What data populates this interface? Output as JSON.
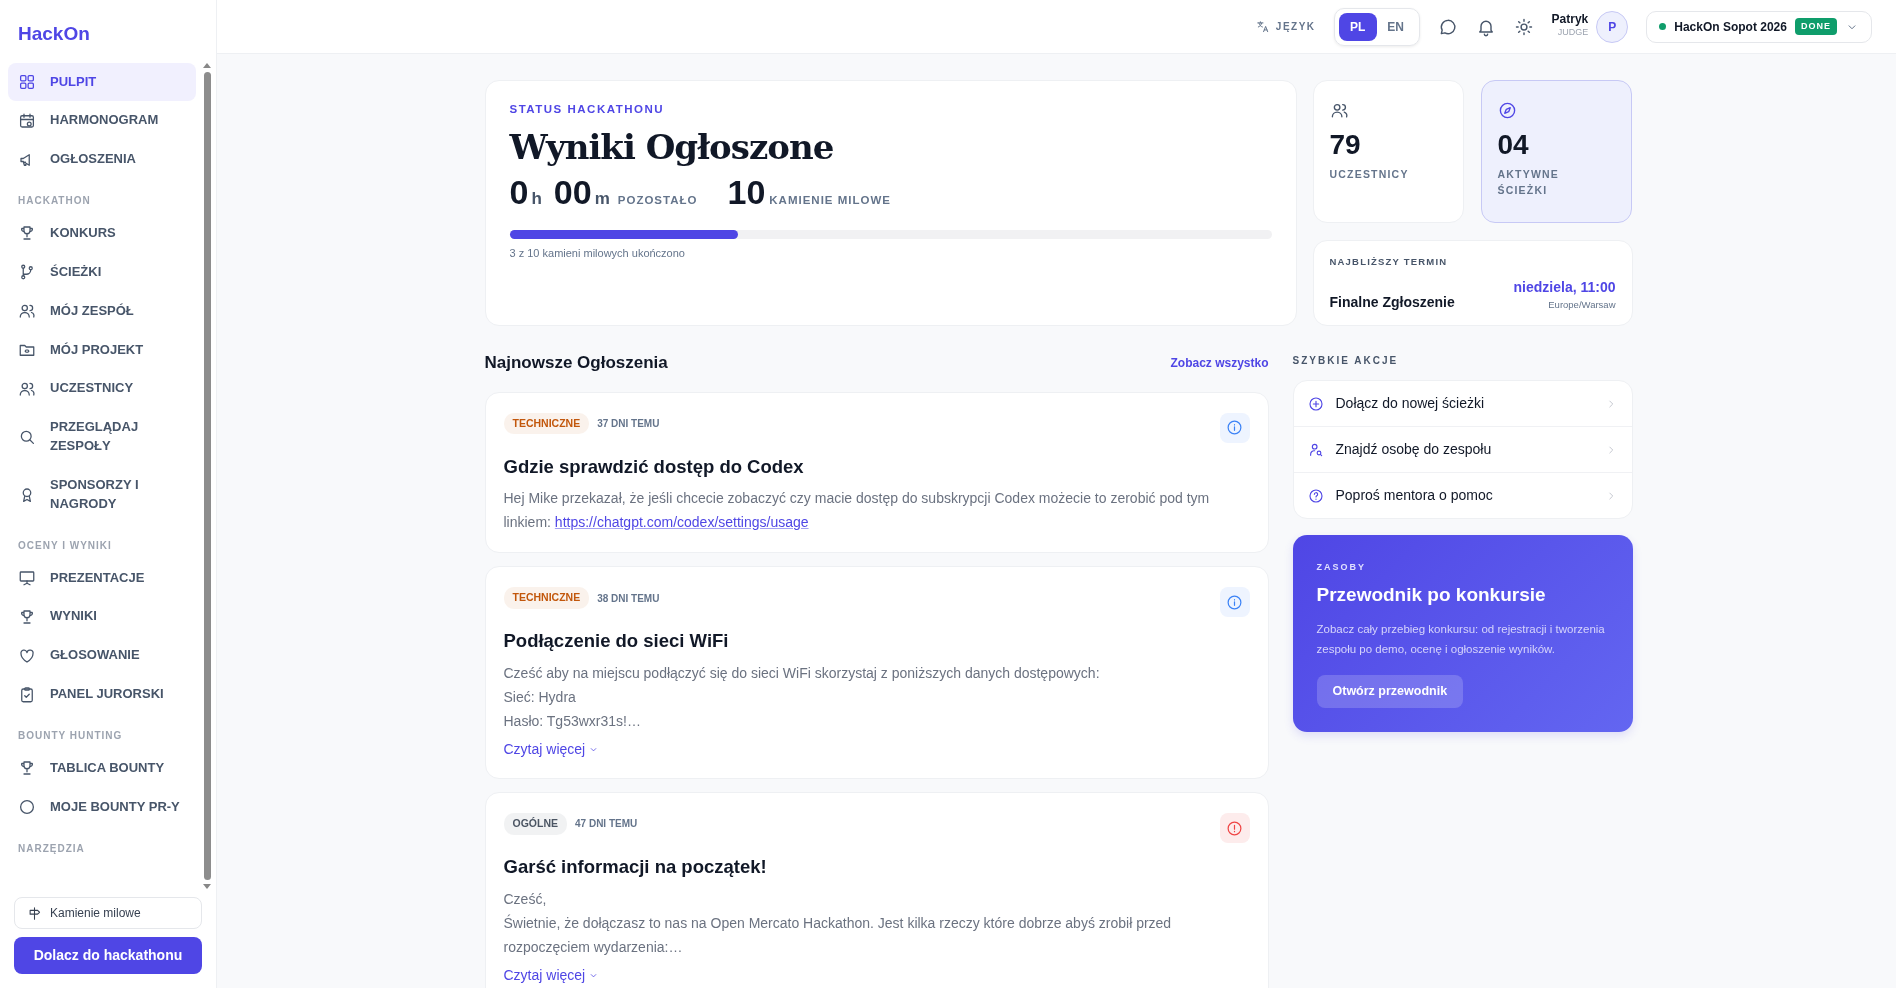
{
  "brand": "HackOn",
  "sidebar": {
    "groups": [
      {
        "items": [
          {
            "label": "PULPIT",
            "selected": true
          },
          {
            "label": "HARMONOGRAM",
            "selected": false
          },
          {
            "label": "OGŁOSZENIA",
            "selected": false
          }
        ]
      },
      {
        "heading": "HACKATHON",
        "items": [
          {
            "label": "KONKURS",
            "selected": false
          },
          {
            "label": "ŚCIEŻKI",
            "selected": false
          },
          {
            "label": "MÓJ ZESPÓŁ",
            "selected": false
          },
          {
            "label": "MÓJ PROJEKT",
            "selected": false
          },
          {
            "label": "UCZESTNICY",
            "selected": false
          },
          {
            "label": "PRZEGLĄDAJ ZESPOŁY",
            "selected": false
          },
          {
            "label": "SPONSORZY I NAGRODY",
            "selected": false
          }
        ]
      },
      {
        "heading": "OCENY I WYNIKI",
        "items": [
          {
            "label": "PREZENTACJE",
            "selected": false
          },
          {
            "label": "WYNIKI",
            "selected": false
          },
          {
            "label": "GŁOSOWANIE",
            "selected": false
          },
          {
            "label": "PANEL JURORSKI",
            "selected": false
          }
        ]
      },
      {
        "heading": "BOUNTY HUNTING",
        "items": [
          {
            "label": "TABLICA BOUNTY",
            "selected": false
          },
          {
            "label": "MOJE BOUNTY PR-Y",
            "selected": false
          }
        ]
      },
      {
        "heading": "NARZĘDZIA"
      }
    ],
    "tools_button": "Kamienie milowe",
    "join_button": "Dolacz do hackathonu"
  },
  "topbar": {
    "language_label": "JĘZYK",
    "languages": [
      {
        "label": "PL",
        "selected": true
      },
      {
        "label": "EN",
        "selected": false
      }
    ],
    "user": {
      "name": "Patryk",
      "role": "JUDGE",
      "initial": "P"
    },
    "event": {
      "name": "HackOn Sopot 2026",
      "status": "DONE"
    }
  },
  "status_card": {
    "eyebrow": "STATUS HACKATHONU",
    "title": "Wyniki Ogłoszone",
    "hours": "0",
    "hours_unit": "h",
    "minutes": "00",
    "minutes_unit": "m",
    "remaining_label": "POZOSTAŁO",
    "milestones": "10",
    "milestones_label": "KAMIENIE MILOWE",
    "level": 0.3,
    "caption": "3 z 10 kamieni milowych ukończono"
  },
  "stats": [
    {
      "value": "79",
      "label": "UCZESTNICY",
      "highlighted": false
    },
    {
      "value": "04",
      "label": "AKTYWNE ŚCIEŻKI",
      "highlighted": true
    }
  ],
  "deadline": {
    "heading": "NAJBLIŻSZY TERMIN",
    "name": "Finalne Zgłoszenie",
    "when": "niedziela, 11:00",
    "timezone": "Europe/Warsaw"
  },
  "announcements": {
    "heading": "Najnowsze Ogłoszenia",
    "see_all": "Zobacz wszystko",
    "items": [
      {
        "tag": "TECHNICZNE",
        "color": "#c2570c",
        "age": "37 DNI TEMU",
        "kind": "info",
        "title": "Gdzie sprawdzić dostęp do Codex",
        "body": [
          "Hej Mike przekazał, że jeśli chcecie zobaczyć czy macie dostęp do subskrypcji Codex możecie to zerobić pod tym linkiem:"
        ],
        "link": "https://chatgpt.com/codex/settings/usage"
      },
      {
        "tag": "TECHNICZNE",
        "color": "#c2570c",
        "age": "38 DNI TEMU",
        "kind": "info",
        "title": "Podłączenie do sieci WiFi",
        "body": [
          "Cześć aby na miejscu podłączyć się do sieci WiFi skorzystaj z poniższych danych dostępowych:",
          "Sieć: Hydra",
          "Hasło: Tg53wxr31s!…"
        ],
        "read_more": "Czytaj więcej"
      },
      {
        "tag": "OGÓLNE",
        "color": "#4b5563",
        "age": "47 DNI TEMU",
        "kind": "alert",
        "title": "Garść informacji na początek!",
        "body": [
          "Cześć,",
          "Świetnie, że dołączasz to nas na Open Mercato Hackathon. Jest kilka rzeczy które dobrze abyś zrobił przed rozpoczęciem wydarzenia:…"
        ],
        "read_more": "Czytaj więcej"
      }
    ]
  },
  "quick_actions": {
    "heading": "SZYBKIE AKCJE",
    "items": [
      {
        "label": "Dołącz do nowej ścieżki"
      },
      {
        "label": "Znajdź osobę do zespołu"
      },
      {
        "label": "Poproś mentora o pomoc"
      }
    ]
  },
  "resources": {
    "eyebrow": "ZASOBY",
    "title": "Przewodnik po konkursie",
    "text": "Zobacz cały przebieg konkursu: od rejestracji i tworzenia zespołu po demo, ocenę i ogłoszenie wyników.",
    "button": "Otwórz przewodnik"
  }
}
